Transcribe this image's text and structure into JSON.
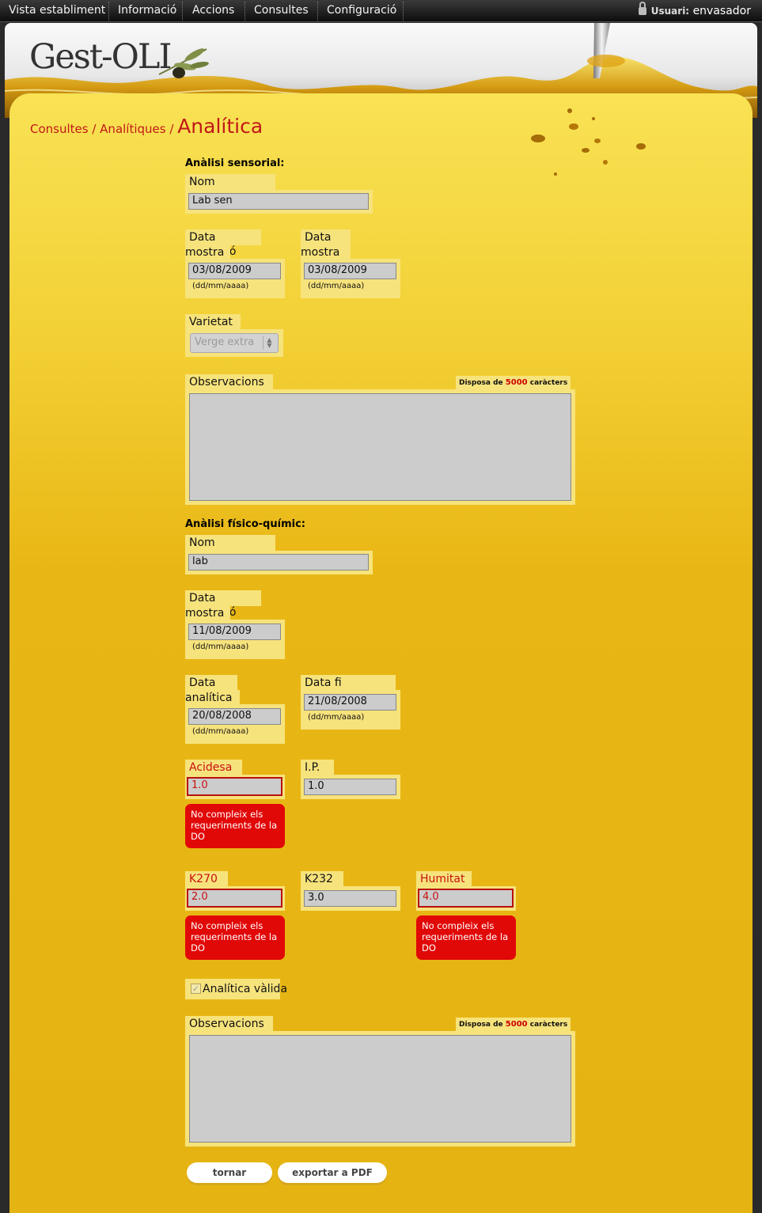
{
  "nav": {
    "items": [
      "Vista establiment",
      "Informació",
      "Accions",
      "Consultes",
      "Configuració"
    ],
    "user_label": "Usuari:",
    "user_name": "envasador"
  },
  "brand": {
    "logo": "Gest-OLI"
  },
  "breadcrumb": {
    "part1": "Consultes",
    "sep": " / ",
    "part2": "Analítiques",
    "current": "Analítica"
  },
  "sensorial": {
    "title": "Anàlisi sensorial:",
    "lab_label": "Nom laboratori",
    "lab_value": "Lab sen",
    "reception_label_1": "Data recepció",
    "reception_label_2": "mostra",
    "reception_value": "03/08/2009",
    "tasting_label_1": "Data tast",
    "tasting_label_2": "mostra",
    "tasting_value": "03/08/2009",
    "date_hint": "(dd/mm/aaaa)",
    "variety_label": "Varietat",
    "variety_value": "Verge extra",
    "obs_label": "Observacions",
    "obs_counter_pre": "Disposa de ",
    "obs_counter_num": "5000",
    "obs_counter_post": " caràcters"
  },
  "physico": {
    "title": "Anàlisi físico-químic:",
    "lab_label": "Nom laboratori",
    "lab_value": "lab",
    "reception_label_1": "Data recepció",
    "reception_label_2": "mostra",
    "reception_value": "11/08/2009",
    "start_label_1": "Data inici",
    "start_label_2": "analítica",
    "start_value": "20/08/2008",
    "end_label": "Data fi analítica",
    "end_value": "21/08/2008",
    "date_hint": "(dd/mm/aaaa)",
    "acidity_label": "Acidesa",
    "acidity_value": "1.0",
    "ip_label": "I.P.",
    "ip_value": "1.0",
    "k270_label": "K270",
    "k270_value": "2.0",
    "k232_label": "K232",
    "k232_value": "3.0",
    "humidity_label": "Humitat",
    "humidity_value": "4.0",
    "error_line1": "No compleix els",
    "error_line2": "requeriments de la",
    "error_line3": "DO",
    "valid_label": "Analítica vàlida",
    "valid_checked": true,
    "obs_label": "Observacions",
    "obs_counter_pre": "Disposa de ",
    "obs_counter_num": "5000",
    "obs_counter_post": " caràcters"
  },
  "buttons": {
    "back": "tornar",
    "export": "exportar a PDF"
  },
  "colors": {
    "error": "#e10808",
    "accent_text": "#c01818",
    "field_bg": "#f7e37c",
    "input_bg": "#cccccc"
  }
}
